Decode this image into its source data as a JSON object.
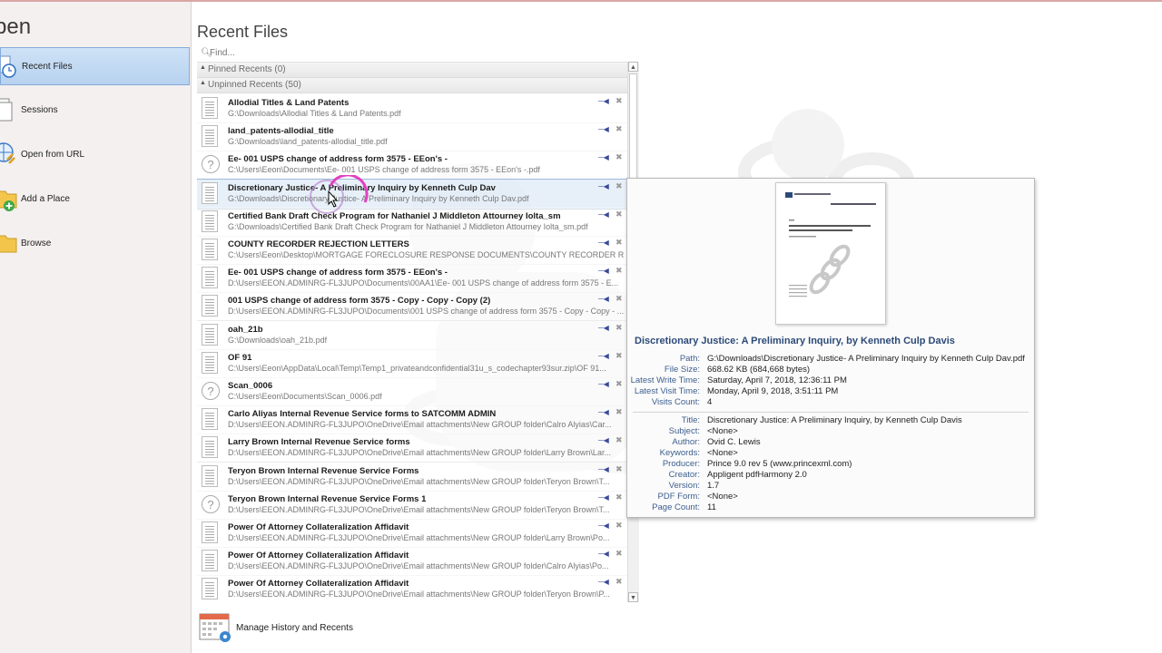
{
  "left": {
    "title": "pen",
    "items": [
      {
        "label": "Recent Files",
        "icon": "recent-files-clock-icon",
        "selected": true
      },
      {
        "label": "Sessions",
        "icon": "sessions-icon",
        "selected": false
      },
      {
        "label": "Open from URL",
        "icon": "globe-link-icon",
        "selected": false
      },
      {
        "label": "Add a Place",
        "icon": "folder-add-icon",
        "selected": false
      },
      {
        "label": "Browse",
        "icon": "folder-icon",
        "selected": false
      }
    ]
  },
  "main": {
    "title": "Recent Files",
    "find_placeholder": "Find...",
    "pinned_label": "Pinned Recents (0)",
    "unpinned_label": "Unpinned Recents (50)",
    "files": [
      {
        "name": "Allodial Titles & Land Patents",
        "path": "G:\\Downloads\\Allodial Titles & Land Patents.pdf",
        "thumb": "doc"
      },
      {
        "name": "land_patents-allodial_title",
        "path": "G:\\Downloads\\land_patents-allodial_title.pdf",
        "thumb": "doc"
      },
      {
        "name": "Ee- 001 USPS change of address form 3575 - EEon's -",
        "path": "C:\\Users\\Eeon\\Documents\\Ee- 001 USPS change of address form 3575 - EEon's -.pdf",
        "thumb": "unknown"
      },
      {
        "name": "Discretionary Justice- A Preliminary Inquiry by Kenneth Culp Dav",
        "path": "G:\\Downloads\\Discretionary Justice- A Preliminary Inquiry by Kenneth Culp Dav.pdf",
        "thumb": "doc",
        "selected": true
      },
      {
        "name": "Certified Bank Draft Check Program for Nathaniel J Middleton Attourney Iolta_sm",
        "path": "G:\\Downloads\\Certified Bank Draft Check Program for Nathaniel J Middleton Attourney Iolta_sm.pdf",
        "thumb": "doc"
      },
      {
        "name": "COUNTY RECORDER REJECTION LETTERS",
        "path": "C:\\Users\\Eeon\\Desktop\\MORTGAGE FORECLOSURE RESPONSE DOCUMENTS\\COUNTY RECORDER REJ...",
        "thumb": "doc"
      },
      {
        "name": "Ee- 001 USPS change of address form 3575 - EEon's -",
        "path": "D:\\Users\\EEON.ADMINRG-FL3JUPO\\Documents\\00AA1\\Ee- 001 USPS change of address form 3575 - E...",
        "thumb": "doc"
      },
      {
        "name": "001 USPS change of address form 3575 - Copy - Copy - Copy (2)",
        "path": "D:\\Users\\EEON.ADMINRG-FL3JUPO\\Documents\\001 USPS change of address form 3575 - Copy - Copy - ...",
        "thumb": "doc"
      },
      {
        "name": "oah_21b",
        "path": "G:\\Downloads\\oah_21b.pdf",
        "thumb": "doc"
      },
      {
        "name": "OF 91",
        "path": "C:\\Users\\Eeon\\AppData\\Local\\Temp\\Temp1_privateandconfidential31u_s_codechapter93sur.zip\\OF 91...",
        "thumb": "doc"
      },
      {
        "name": "Scan_0006",
        "path": "C:\\Users\\Eeon\\Documents\\Scan_0006.pdf",
        "thumb": "unknown"
      },
      {
        "name": "Carlo Aliyas Internal Revenue Service forms to SATCOMM ADMIN",
        "path": "D:\\Users\\EEON.ADMINRG-FL3JUPO\\OneDrive\\Email attachments\\New GROUP folder\\Calro Alyias\\Car...",
        "thumb": "doc"
      },
      {
        "name": "Larry Brown Internal Revenue Service forms",
        "path": "D:\\Users\\EEON.ADMINRG-FL3JUPO\\OneDrive\\Email attachments\\New GROUP folder\\Larry Brown\\Lar...",
        "thumb": "doc"
      },
      {
        "name": "Teryon Brown Internal Revenue Service Forms",
        "path": "D:\\Users\\EEON.ADMINRG-FL3JUPO\\OneDrive\\Email attachments\\New GROUP folder\\Teryon Brown\\T...",
        "thumb": "doc"
      },
      {
        "name": "Teryon Brown Internal Revenue Service Forms 1",
        "path": "D:\\Users\\EEON.ADMINRG-FL3JUPO\\OneDrive\\Email attachments\\New GROUP folder\\Teryon Brown\\T...",
        "thumb": "unknown"
      },
      {
        "name": "Power Of Attorney Collateralization Affidavit",
        "path": "D:\\Users\\EEON.ADMINRG-FL3JUPO\\OneDrive\\Email attachments\\New GROUP folder\\Larry Brown\\Po...",
        "thumb": "doc"
      },
      {
        "name": "Power Of Attorney Collateralization Affidavit",
        "path": "D:\\Users\\EEON.ADMINRG-FL3JUPO\\OneDrive\\Email attachments\\New GROUP folder\\Calro Alyias\\Po...",
        "thumb": "doc"
      },
      {
        "name": "Power Of Attorney Collateralization Affidavit",
        "path": "D:\\Users\\EEON.ADMINRG-FL3JUPO\\OneDrive\\Email attachments\\New GROUP folder\\Teryon Brown\\P...",
        "thumb": "doc"
      }
    ],
    "manage_label": "Manage History and Recents"
  },
  "tooltip": {
    "title": "Discretionary Justice: A Preliminary Inquiry, by Kenneth Culp Davis",
    "file_props": [
      {
        "k": "Path:",
        "v": "G:\\Downloads\\Discretionary Justice- A Preliminary Inquiry by Kenneth Culp Dav.pdf"
      },
      {
        "k": "File Size:",
        "v": "668.62 KB (684,668 bytes)"
      },
      {
        "k": "Latest Write Time:",
        "v": "Saturday, April 7, 2018, 12:36:11 PM"
      },
      {
        "k": "Latest Visit Time:",
        "v": "Monday, April 9, 2018, 3:51:11 PM"
      },
      {
        "k": "Visits Count:",
        "v": "4"
      }
    ],
    "doc_props": [
      {
        "k": "Title:",
        "v": "Discretionary Justice: A Preliminary Inquiry, by Kenneth Culp Davis"
      },
      {
        "k": "Subject:",
        "v": "<None>"
      },
      {
        "k": "Author:",
        "v": "Ovid C. Lewis"
      },
      {
        "k": "Keywords:",
        "v": "<None>"
      },
      {
        "k": "Producer:",
        "v": "Prince 9.0 rev 5 (www.princexml.com)"
      },
      {
        "k": "Creator:",
        "v": "Appligent pdfHarmony 2.0"
      },
      {
        "k": "Version:",
        "v": "1.7"
      },
      {
        "k": "PDF Form:",
        "v": "<None>"
      },
      {
        "k": "Page Count:",
        "v": "11"
      }
    ]
  },
  "colors": {
    "accent": "#3d5f8e",
    "selected_bg": "#cfe2f6",
    "pin": "#3a4a9a"
  }
}
